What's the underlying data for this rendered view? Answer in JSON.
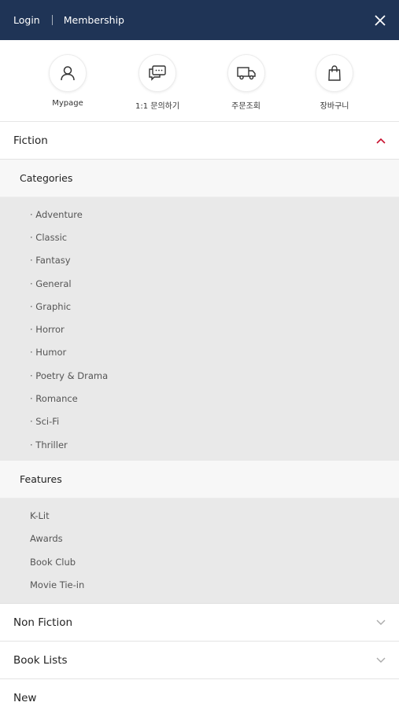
{
  "topbar": {
    "login": "Login",
    "membership": "Membership"
  },
  "quick_links": [
    {
      "label": "Mypage",
      "icon": "user-icon"
    },
    {
      "label": "1:1 문의하기",
      "icon": "chat-icon"
    },
    {
      "label": "주문조회",
      "icon": "truck-icon"
    },
    {
      "label": "장바구니",
      "icon": "shopping-bag-icon"
    }
  ],
  "menu": {
    "fiction": {
      "label": "Fiction",
      "expanded": true,
      "accent": "#c8102e",
      "categories_heading": "Categories",
      "categories": [
        "· Adventure",
        "· Classic",
        "· Fantasy",
        "· General",
        "· Graphic",
        "· Horror",
        "· Humor",
        "· Poetry & Drama",
        "· Romance",
        "· Sci-Fi",
        "· Thriller"
      ],
      "features_heading": "Features",
      "features": [
        "K-Lit",
        "Awards",
        "Book Club",
        "Movie Tie-in"
      ]
    },
    "non_fiction": {
      "label": "Non Fiction",
      "expanded": false
    },
    "book_lists": {
      "label": "Book Lists",
      "expanded": false
    },
    "new": {
      "label": "New"
    }
  },
  "colors": {
    "topbar_bg": "#1f3456",
    "submenu_bg": "#e9e9e9",
    "subhead_bg": "#f7f7f7"
  }
}
